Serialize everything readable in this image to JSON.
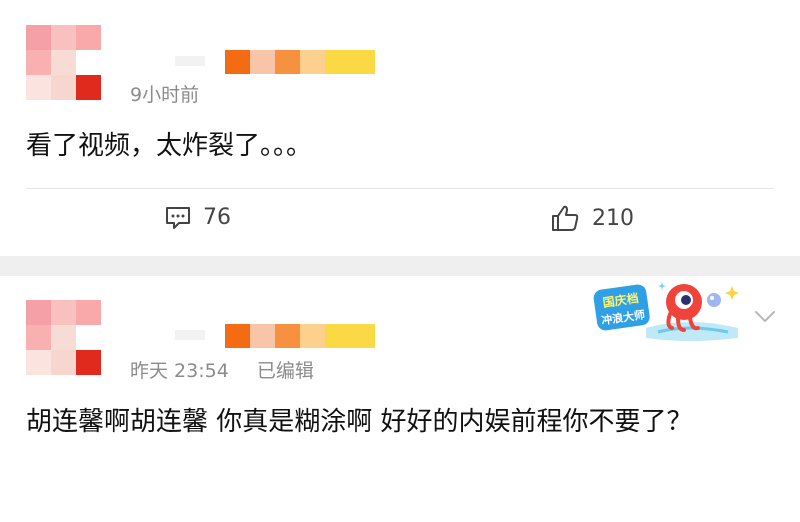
{
  "comments": [
    {
      "time": "9小时前",
      "edited": "",
      "text": "看了视频，太炸裂了。。。",
      "reply_count": "76",
      "like_count": "210",
      "avatar_colors": [
        "#f4a0a6",
        "#f8c8c0",
        "#fde8e8",
        "#f9b0b0",
        "#f3d3cd",
        "#ffffff",
        "#fbe3df",
        "#f2c2b8",
        "#e02a1e"
      ],
      "name_colors": [
        "#f36b12",
        "#f8c5a8",
        "#f5913f",
        "#fdd08e",
        "#fbd944",
        "#fbd944"
      ]
    },
    {
      "time": "昨天 23:54",
      "edited": "已编辑",
      "text": "胡连馨啊胡连馨 你真是糊涂啊 好好的内娱前程你不要了？",
      "avatar_colors": [
        "#f4a0a6",
        "#f8c8c0",
        "#fde8e8",
        "#f9b0b0",
        "#f3d3cd",
        "#ffffff",
        "#fbe3df",
        "#f2c2b8",
        "#e02a1e"
      ],
      "name_colors": [
        "#f36b12",
        "#f8c5a8",
        "#f5913f",
        "#fdd08e",
        "#fbd944",
        "#fbd944"
      ]
    }
  ],
  "badge": {
    "line1": "国庆档",
    "line2": "冲浪大师"
  },
  "icons": {
    "comment": "comment-icon",
    "like": "thumbs-up-icon",
    "expand": "chevron-down-icon"
  }
}
